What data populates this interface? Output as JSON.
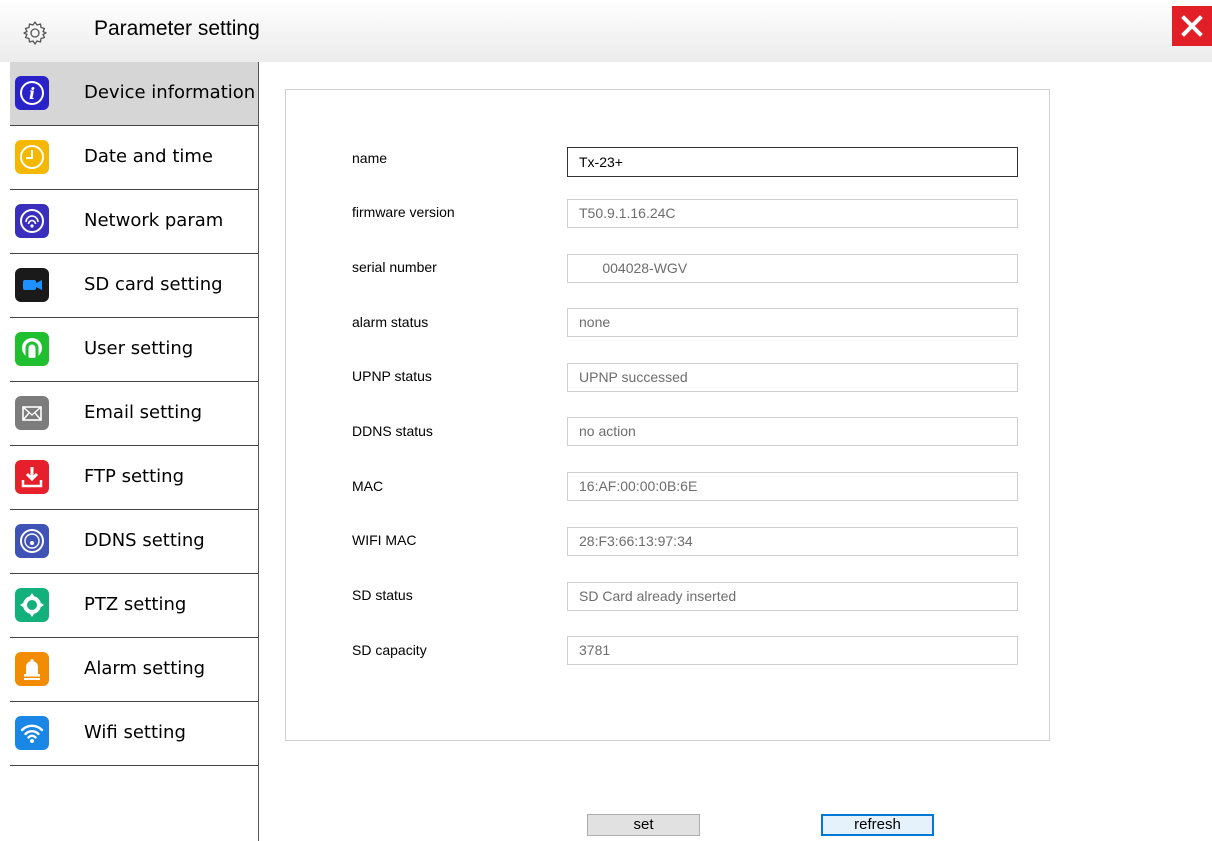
{
  "window": {
    "title": "Parameter setting",
    "close_label": "X"
  },
  "sidebar": {
    "items": [
      {
        "label": "Device information",
        "icon": "info-icon",
        "color": "#2a22c9",
        "active": true
      },
      {
        "label": "Date and time",
        "icon": "clock-icon",
        "color": "#f5b800"
      },
      {
        "label": "Network param",
        "icon": "network-icon",
        "color": "#3a2fbd"
      },
      {
        "label": "SD card setting",
        "icon": "camera-icon",
        "color": "#1a1a1a"
      },
      {
        "label": "User setting",
        "icon": "user-icon",
        "color": "#1fbf2f"
      },
      {
        "label": "Email setting",
        "icon": "envelope-icon",
        "color": "#7c7c7c"
      },
      {
        "label": "FTP setting",
        "icon": "download-icon",
        "color": "#e5202a"
      },
      {
        "label": "DDNS setting",
        "icon": "ddns-icon",
        "color": "#3f52b5"
      },
      {
        "label": "PTZ setting",
        "icon": "ptz-icon",
        "color": "#12b07a"
      },
      {
        "label": "Alarm setting",
        "icon": "bell-icon",
        "color": "#f28c00"
      },
      {
        "label": "Wifi setting",
        "icon": "wifi-icon",
        "color": "#1a86e6"
      }
    ]
  },
  "device_info": {
    "fields": [
      {
        "label": "name",
        "value": "Tx-23+"
      },
      {
        "label": "firmware version",
        "value": "T50.9.1.16.24C"
      },
      {
        "label": "serial number",
        "value": "      004028-WGV"
      },
      {
        "label": "alarm status",
        "value": "none"
      },
      {
        "label": "UPNP status",
        "value": "UPNP successed"
      },
      {
        "label": "DDNS status",
        "value": "no action"
      },
      {
        "label": "MAC",
        "value": "16:AF:00:00:0B:6E"
      },
      {
        "label": "WIFI MAC",
        "value": "28:F3:66:13:97:34"
      },
      {
        "label": "SD status",
        "value": "SD Card already inserted"
      },
      {
        "label": "SD capacity",
        "value": "3781"
      }
    ]
  },
  "buttons": {
    "set": "set",
    "refresh": "refresh"
  },
  "colors": {
    "accent": "#0078d7",
    "close": "#e21e26",
    "active_item": "#d6d6d6"
  }
}
